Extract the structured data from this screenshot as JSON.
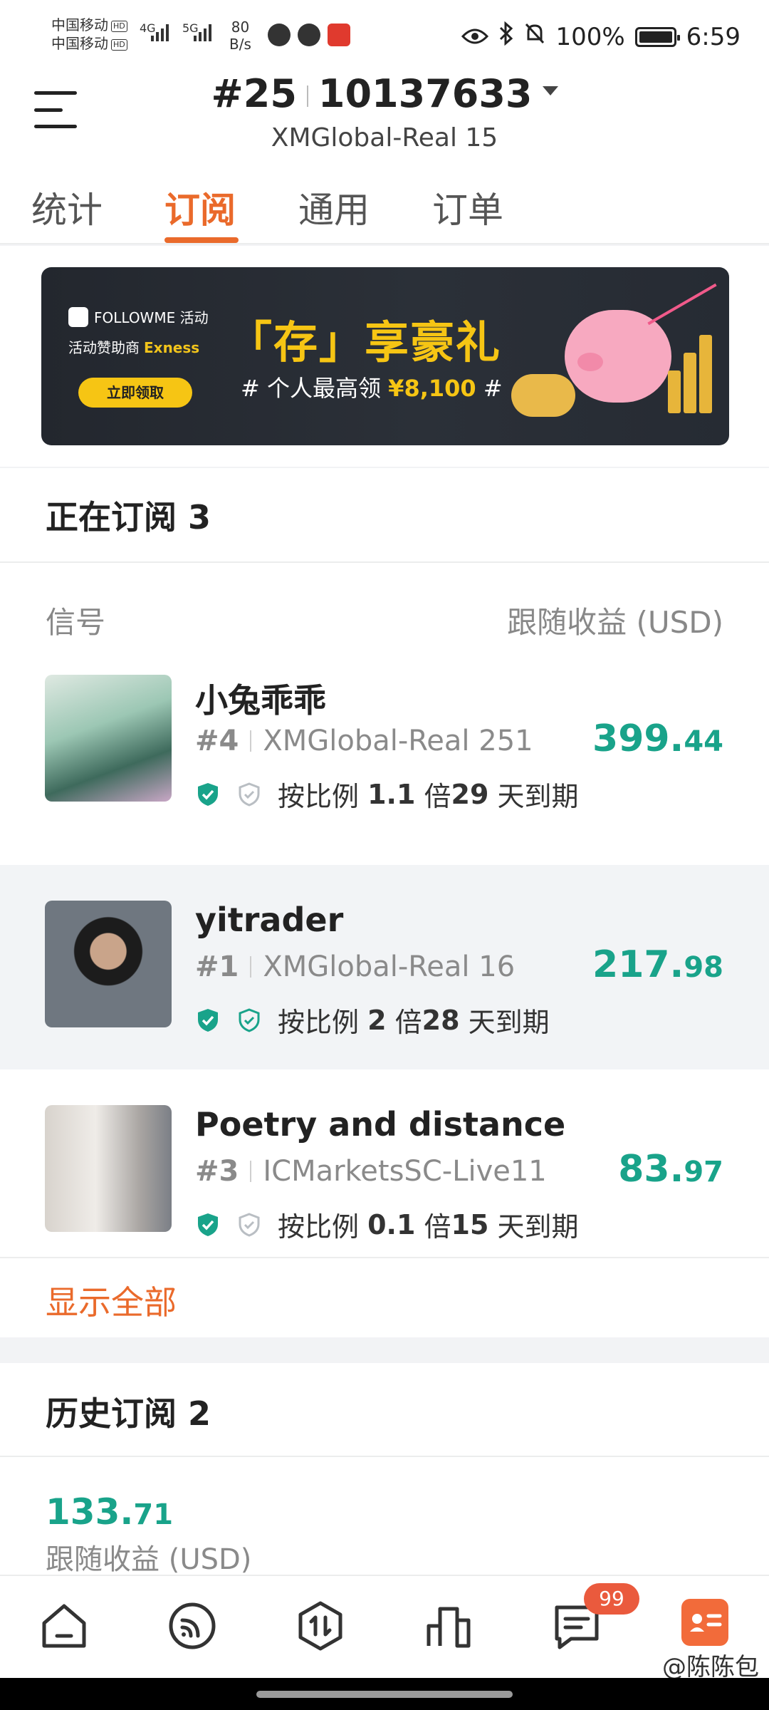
{
  "status_bar": {
    "carrier1": "中国移动",
    "carrier2": "中国移动",
    "hd": "HD",
    "net1": "4G",
    "net2": "5G",
    "speed_value": "80",
    "speed_unit": "B/s",
    "battery": "100%",
    "time": "6:59"
  },
  "header": {
    "rank": "#25",
    "account": "10137633",
    "server": "XMGlobal-Real 15"
  },
  "tabs": [
    {
      "label": "统计"
    },
    {
      "label": "订阅"
    },
    {
      "label": "通用"
    },
    {
      "label": "订单"
    }
  ],
  "banner": {
    "brand": "FOLLOWME 活动",
    "sponsor_prefix": "活动赞助商",
    "sponsor_name": "Exness",
    "button": "立即领取",
    "title": "「存」享豪礼",
    "subtitle_prefix": "# 个人最高领",
    "subtitle_amount": "¥8,100",
    "subtitle_suffix": "#"
  },
  "current": {
    "title": "正在订阅 3",
    "col_signal": "信号",
    "col_profit": "跟随收益 (USD)",
    "rows": [
      {
        "name": "小兔乖乖",
        "rank": "#4",
        "server": "XMGlobal-Real 251",
        "ratio_label": "按比例",
        "ratio": "1.1",
        "times": "倍",
        "days": "29",
        "days_label": "天到期",
        "amount_int": "399.",
        "amount_dec": "44"
      },
      {
        "name": "yitrader",
        "rank": "#1",
        "server": "XMGlobal-Real 16",
        "ratio_label": "按比例",
        "ratio": "2",
        "times": "倍",
        "days": "28",
        "days_label": "天到期",
        "amount_int": "217.",
        "amount_dec": "98"
      },
      {
        "name": "Poetry and distance",
        "rank": "#3",
        "server": "ICMarketsSC-Live11",
        "ratio_label": "按比例",
        "ratio": "0.1",
        "times": "倍",
        "days": "15",
        "days_label": "天到期",
        "amount_int": "83.",
        "amount_dec": "97"
      }
    ],
    "show_all": "显示全部"
  },
  "history": {
    "title": "历史订阅 2",
    "amount_int": "133.",
    "amount_dec": "71",
    "label": "跟随收益 (USD)"
  },
  "bottom_nav": {
    "badge": "99",
    "watermark": "@陈陈包"
  },
  "colors": {
    "accent": "#ea6a2b",
    "profit": "#19a38a",
    "verified": "#19a38a"
  }
}
